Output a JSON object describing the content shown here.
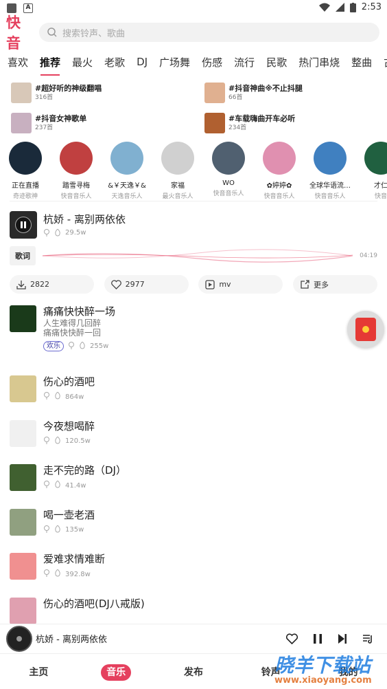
{
  "status": {
    "time": "2:53"
  },
  "search": {
    "placeholder": "搜索铃声、歌曲",
    "logo": "快音"
  },
  "tabs": [
    "喜欢",
    "推荐",
    "最火",
    "老歌",
    "DJ",
    "广场舞",
    "伤感",
    "流行",
    "民歌",
    "热门串烧",
    "整曲",
    "古风"
  ],
  "active_tab": "推荐",
  "topics": [
    {
      "title": "#超好听的神级翻唱",
      "count": "316首",
      "color": "#d8c8b8"
    },
    {
      "title": "#抖音神曲※不止抖腿",
      "count": "66首",
      "color": "#e0b090"
    },
    {
      "title": "#抖音女神歌单",
      "count": "237首",
      "color": "#c8b0c0"
    },
    {
      "title": "#车载嗨曲开车必听",
      "count": "234首",
      "color": "#b06030"
    }
  ],
  "singers": [
    {
      "name": "正在直播",
      "sub": "奇迹歌神",
      "color": "#1a2a3a"
    },
    {
      "name": "踏雪寻梅",
      "sub": "快音音乐人",
      "color": "#c04040"
    },
    {
      "name": "&￥天逸￥&",
      "sub": "天逸音乐人",
      "color": "#80b0d0"
    },
    {
      "name": "家福",
      "sub": "最火音乐人",
      "color": "#d0d0d0"
    },
    {
      "name": "WO",
      "sub": "快音音乐人",
      "color": "#506070"
    },
    {
      "name": "✿婷婷✿",
      "sub": "快音音乐人",
      "color": "#e090b0"
    },
    {
      "name": "全球华语流…",
      "sub": "快音音乐人",
      "color": "#4080c0"
    },
    {
      "name": "才仁",
      "sub": "快音",
      "color": "#206040"
    }
  ],
  "now_playing": {
    "title": "杭娇 - 离别两依依",
    "plays": "29.5w",
    "lyric_label": "歌词",
    "duration": "04:19",
    "download": "2822",
    "likes": "2977",
    "mv": "mv",
    "more": "更多"
  },
  "songs": [
    {
      "title": "痛痛快快醉一场",
      "desc1": "人生难得几回醉",
      "desc2": "痛痛快快醉一回",
      "tag": "欢乐",
      "plays": "255w",
      "color": "#1a3a1a"
    },
    {
      "title": "伤心的酒吧",
      "plays": "864w",
      "color": "#d8c890"
    },
    {
      "title": "今夜想喝醉",
      "plays": "120.5w",
      "color": "#f0f0f0"
    },
    {
      "title": "走不完的路（DJ）",
      "plays": "41.4w",
      "color": "#406030"
    },
    {
      "title": "喝一壶老酒",
      "plays": "135w",
      "color": "#90a080"
    },
    {
      "title": "爱难求情难断",
      "plays": "392.8w",
      "color": "#f09090"
    },
    {
      "title": "伤心的酒吧(DJ八戒版)",
      "plays": "",
      "color": "#e0a0b0"
    }
  ],
  "player": {
    "title": "杭娇 - 离别两依依"
  },
  "nav": [
    "主页",
    "音乐",
    "发布",
    "铃声",
    "我的"
  ],
  "active_nav": "音乐",
  "watermark": {
    "main": "晓羊下载站",
    "sub": "www.xiaoyang.com"
  }
}
